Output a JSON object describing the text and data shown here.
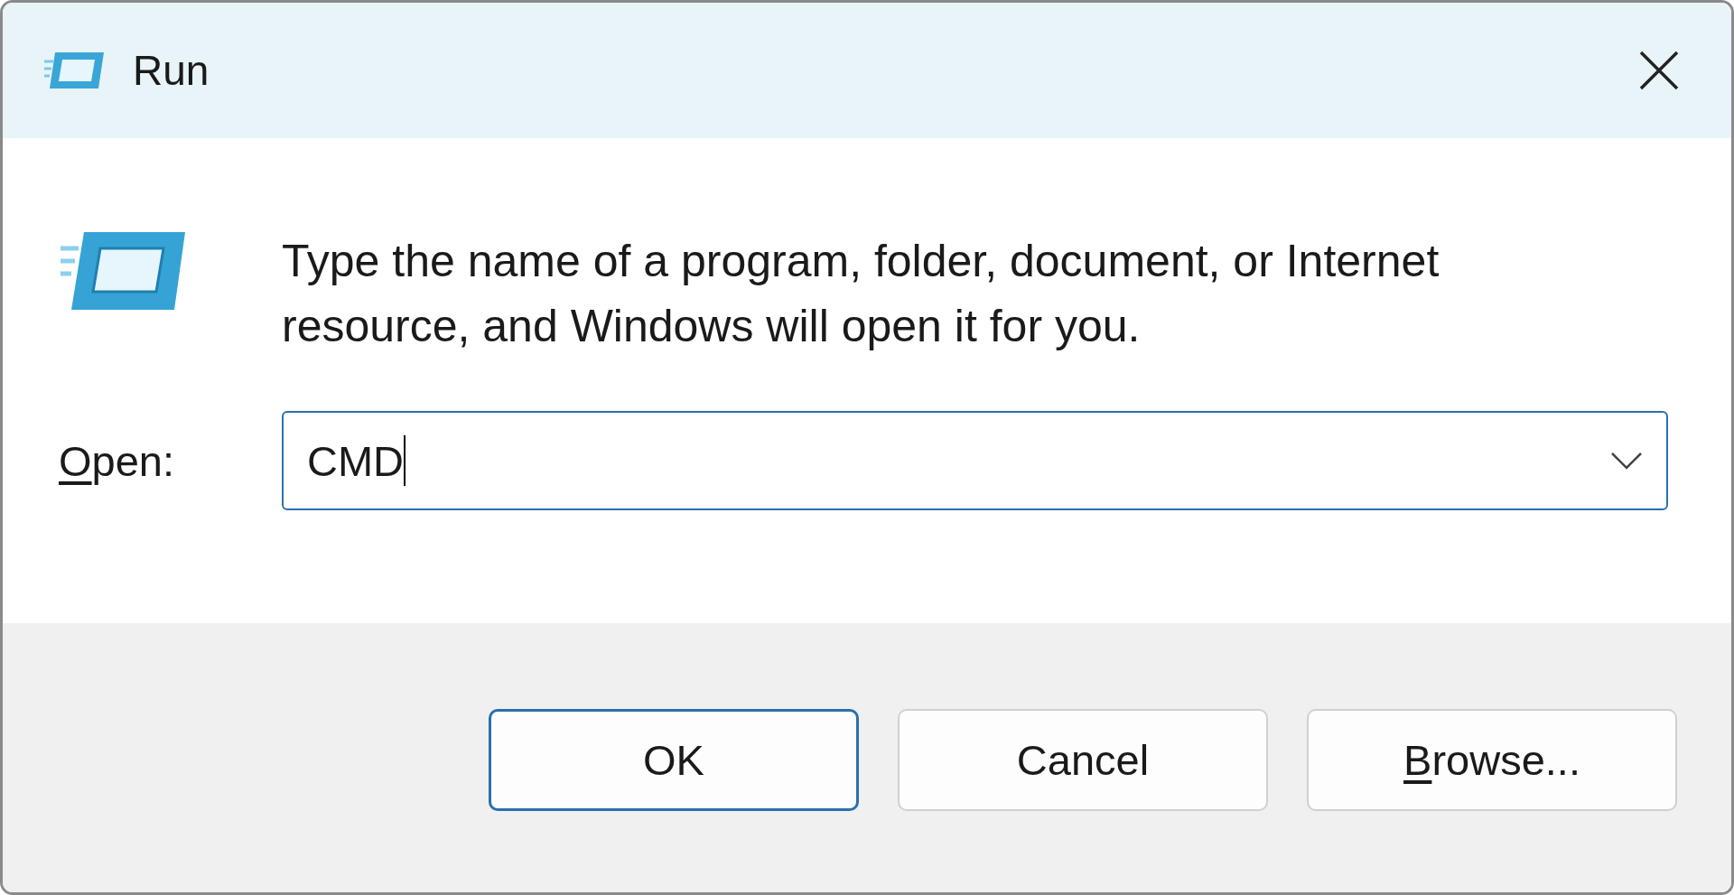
{
  "window": {
    "title": "Run"
  },
  "description": "Type the name of a program, folder, document, or Internet resource, and Windows will open it for you.",
  "open_field": {
    "label": "Open:",
    "label_underline_first": true,
    "value": "CMD",
    "focused": true
  },
  "buttons": [
    {
      "label": "OK",
      "default": true,
      "underline_first": false
    },
    {
      "label": "Cancel",
      "default": false,
      "underline_first": false
    },
    {
      "label": "Browse...",
      "default": false,
      "underline_first": true
    }
  ]
}
